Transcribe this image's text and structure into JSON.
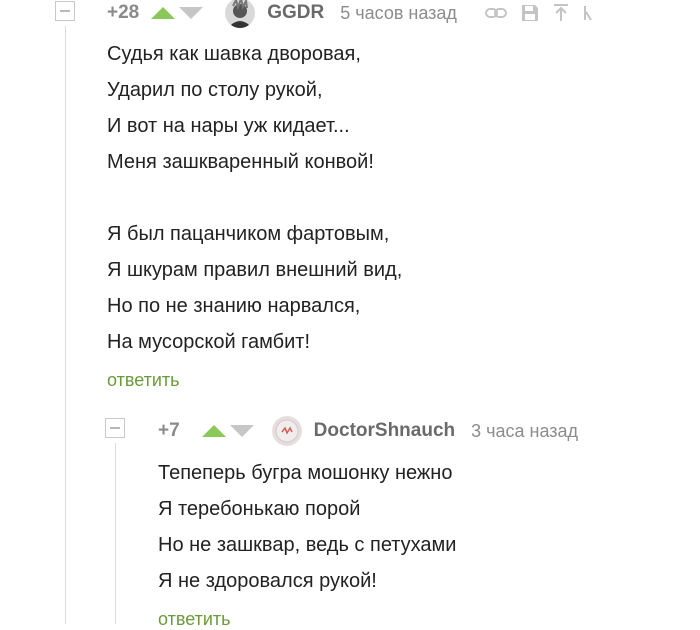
{
  "comments": [
    {
      "rating": "+28",
      "author": "GGDR",
      "time": "5 часов назад",
      "lines": [
        "Судья как шавка дворовая,",
        "Ударил по столу рукой,",
        "И вот на нары уж кидает...",
        "Меня зашкваренный конвой!",
        "",
        "Я был пацанчиком фартовым,",
        "Я шкурам правил внешний вид,",
        "Но по не знанию нарвался,",
        "На мусорской гамбит!"
      ],
      "reply_label": "ответить",
      "icons": [
        "link-icon",
        "save-icon",
        "arrow-up-icon",
        "more-icon"
      ]
    },
    {
      "rating": "+7",
      "author": "DoctorShnauch",
      "time": "3 часа назад",
      "lines": [
        "Тепеперь бугра мошонку нежно",
        "Я теребонькаю порой",
        "Но не зашквар, ведь с петухами",
        "Я не здоровался рукой!"
      ],
      "reply_label": "ответить"
    }
  ],
  "colors": {
    "vote_up": "#8ac858",
    "vote_down": "#c6c6c6",
    "reply_link": "#6a9a3a"
  }
}
